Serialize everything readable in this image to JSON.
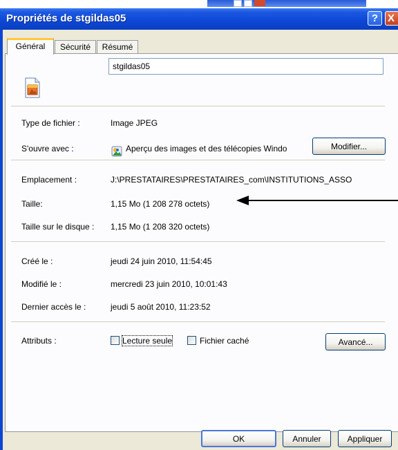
{
  "window": {
    "title": "Propriétés de stgildas05",
    "help_glyph": "?",
    "close_glyph": "X"
  },
  "tabs": [
    {
      "label": "Général",
      "active": true
    },
    {
      "label": "Sécurité",
      "active": false
    },
    {
      "label": "Résumé",
      "active": false
    }
  ],
  "general": {
    "file_name": "stgildas05",
    "file_icon": "jpeg-file-icon",
    "type_label": "Type de fichier :",
    "type_value": "Image JPEG",
    "opens_with_label": "S'ouvre avec :",
    "opens_with_icon": "image-viewer-icon",
    "opens_with_value": "Aperçu des images et des télécopies Windo",
    "modify_button": "Modifier...",
    "location_label": "Emplacement :",
    "location_value": "J:\\PRESTATAIRES\\PRESTATAIRES_com\\INSTITUTIONS_ASSO",
    "size_label": "Taille:",
    "size_value": "1,15 Mo (1 208 278 octets)",
    "size_on_disk_label": "Taille sur le disque :",
    "size_on_disk_value": "1,15 Mo (1 208 320 octets)",
    "created_label": "Créé le :",
    "created_value": "jeudi 24 juin 2010, 11:54:45",
    "modified_label": "Modifié le :",
    "modified_value": "mercredi 23 juin 2010, 10:01:43",
    "accessed_label": "Dernier accès le :",
    "accessed_value": "jeudi 5 août 2010, 11:23:52",
    "attributes_label": "Attributs :",
    "readonly_label": "Lecture seule",
    "hidden_label": "Fichier caché",
    "advanced_button": "Avancé..."
  },
  "buttons": {
    "ok": "OK",
    "cancel": "Annuler",
    "apply": "Appliquer"
  },
  "annotation": {
    "arrow_icon": "left-arrow-icon",
    "color": "#000000"
  },
  "colors": {
    "titlebar": "#0d47d6",
    "dialog_bg": "#ece9d8",
    "panel_bg": "#fcfcfe",
    "active_tab_accent": "#ffc83c"
  }
}
